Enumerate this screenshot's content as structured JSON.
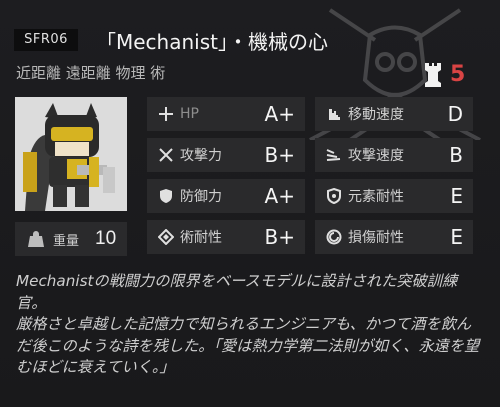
{
  "header": {
    "id_tag": "SFR06",
    "title": "「Mechanist」・機械の心",
    "tags": "近距離 遠距離 物理 術",
    "rank": "5"
  },
  "weight": {
    "label": "重量",
    "value": "10"
  },
  "stats": [
    {
      "name": "HP",
      "grade": "A+",
      "icon": "plus-icon"
    },
    {
      "name": "移動速度",
      "grade": "D",
      "icon": "boot-icon"
    },
    {
      "name": "攻撃力",
      "grade": "B+",
      "icon": "crossed-swords-icon"
    },
    {
      "name": "攻撃速度",
      "grade": "B",
      "icon": "speed-lines-icon"
    },
    {
      "name": "防御力",
      "grade": "A+",
      "icon": "shield-icon"
    },
    {
      "name": "元素耐性",
      "grade": "E",
      "icon": "element-shield-icon"
    },
    {
      "name": "術耐性",
      "grade": "B+",
      "icon": "diamond-ring-icon"
    },
    {
      "name": "損傷耐性",
      "grade": "E",
      "icon": "swirl-icon"
    }
  ],
  "description": [
    "Mechanistの戦闘力の限界をベースモデルに設計された突破訓練官。",
    "厳格さと卓越した記憶力で知られるエンジニアも、かつて酒を飲んだ後このような詩を残した。「愛は熱力学第二法則が如く、永遠を望むほどに衰えていく。」"
  ],
  "colors": {
    "rank": "#d94444",
    "panel": "#2a2a2c",
    "background": "#1c1c1e"
  }
}
